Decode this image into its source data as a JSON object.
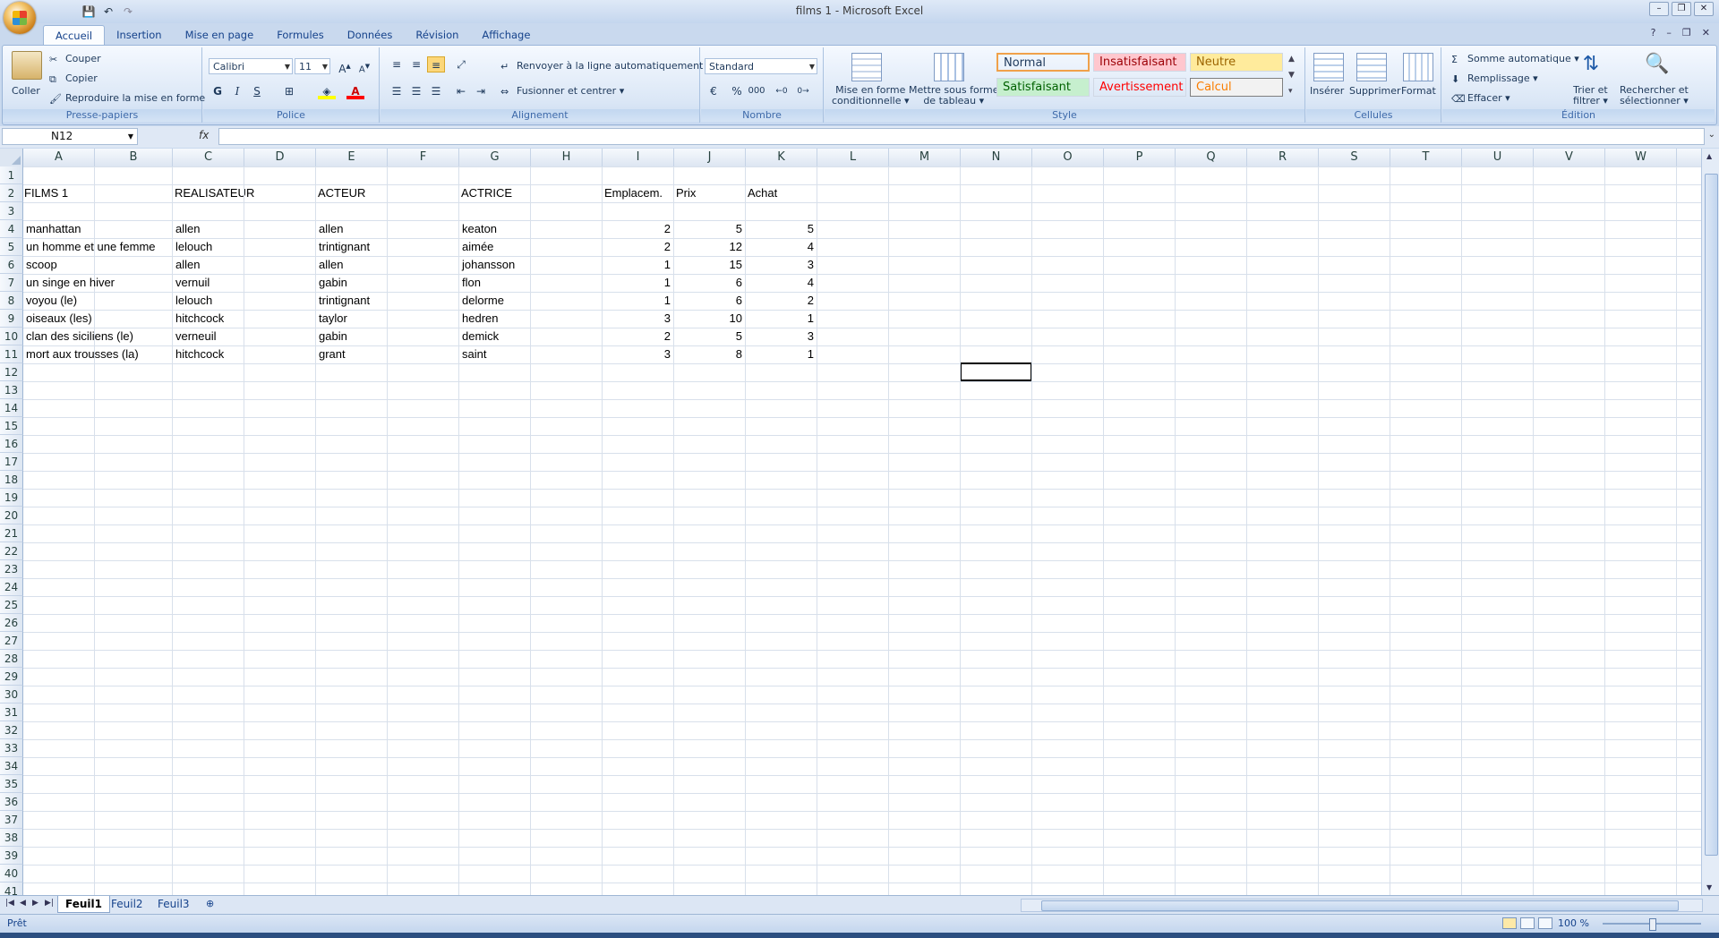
{
  "window": {
    "title": "films 1 - Microsoft Excel",
    "controls": [
      "–",
      "❐",
      "✕"
    ]
  },
  "qat": {
    "icons": [
      "save-icon",
      "undo-icon",
      "redo-icon"
    ]
  },
  "tabs": [
    {
      "label": "Accueil",
      "active": true
    },
    {
      "label": "Insertion"
    },
    {
      "label": "Mise en page"
    },
    {
      "label": "Formules"
    },
    {
      "label": "Données"
    },
    {
      "label": "Révision"
    },
    {
      "label": "Affichage"
    }
  ],
  "ribbon": {
    "clipboard": {
      "label": "Presse-papiers",
      "paste": "Coller",
      "cut": "Couper",
      "copy": "Copier",
      "format_painter": "Reproduire la mise en forme"
    },
    "font": {
      "label": "Police",
      "name": "Calibri",
      "size": "11",
      "bold": "G",
      "italic": "I",
      "underline": "S"
    },
    "alignment": {
      "label": "Alignement",
      "wrap": "Renvoyer à la ligne automatiquement",
      "merge": "Fusionner et centrer"
    },
    "number": {
      "label": "Nombre",
      "format": "Standard",
      "percent": "%",
      "thousands": "000"
    },
    "style": {
      "label": "Style",
      "conditional": [
        "Mise en forme",
        "conditionnelle"
      ],
      "table": [
        "Mettre sous forme",
        "de tableau"
      ],
      "cells": [
        {
          "label": "Normal",
          "bg": "#ffffff",
          "fg": "#000000"
        },
        {
          "label": "Insatisfaisant",
          "bg": "#ffc7ce",
          "fg": "#9c0006"
        },
        {
          "label": "Neutre",
          "bg": "#ffeb9c",
          "fg": "#9c6500"
        },
        {
          "label": "Satisfaisant",
          "bg": "#c6efce",
          "fg": "#006100"
        },
        {
          "label": "Avertissement",
          "bg": "#ffffff",
          "fg": "#ff0000"
        },
        {
          "label": "Calcul",
          "bg": "#f2f2f2",
          "fg": "#fa7d00"
        }
      ]
    },
    "cells": {
      "label": "Cellules",
      "insert": "Insérer",
      "delete": "Supprimer",
      "format": "Format"
    },
    "editing": {
      "label": "Édition",
      "autosum": "Somme automatique",
      "fill": "Remplissage",
      "clear": "Effacer",
      "sort": [
        "Trier et",
        "filtrer"
      ],
      "find": [
        "Rechercher et",
        "sélectionner"
      ]
    }
  },
  "formula_bar": {
    "name_box": "N12",
    "fx": "fx",
    "value": ""
  },
  "sheet": {
    "columns": [
      "A",
      "B",
      "C",
      "D",
      "E",
      "F",
      "G",
      "H",
      "I",
      "J",
      "K",
      "L",
      "M",
      "N",
      "O",
      "P",
      "Q",
      "R",
      "S",
      "T",
      "U",
      "V",
      "W"
    ],
    "row_count": 41,
    "headers": {
      "A2": "FILMS 1",
      "C2": "REALISATEUR",
      "E2": "ACTEUR",
      "G2": "ACTRICE",
      "I2": "Emplacem.",
      "J2": "Prix",
      "K2": "Achat"
    },
    "rows": [
      {
        "film": "manhattan",
        "realisateur": "allen",
        "acteur": "allen",
        "actrice": "keaton",
        "emplacement": 2,
        "prix": 5,
        "achat": 5
      },
      {
        "film": "un homme et une femme",
        "realisateur": "lelouch",
        "acteur": "trintignant",
        "actrice": "aimée",
        "emplacement": 2,
        "prix": 12,
        "achat": 4
      },
      {
        "film": "scoop",
        "realisateur": "allen",
        "acteur": "allen",
        "actrice": "johansson",
        "emplacement": 1,
        "prix": 15,
        "achat": 3
      },
      {
        "film": "un singe en hiver",
        "realisateur": "vernuil",
        "acteur": "gabin",
        "actrice": "flon",
        "emplacement": 1,
        "prix": 6,
        "achat": 4
      },
      {
        "film": "voyou (le)",
        "realisateur": "lelouch",
        "acteur": "trintignant",
        "actrice": "delorme",
        "emplacement": 1,
        "prix": 6,
        "achat": 2
      },
      {
        "film": "oiseaux (les)",
        "realisateur": "hitchcock",
        "acteur": "taylor",
        "actrice": "hedren",
        "emplacement": 3,
        "prix": 10,
        "achat": 1
      },
      {
        "film": "clan des siciliens (le)",
        "realisateur": "verneuil",
        "acteur": "gabin",
        "actrice": "demick",
        "emplacement": 2,
        "prix": 5,
        "achat": 3
      },
      {
        "film": "mort aux trousses (la)",
        "realisateur": "hitchcock",
        "acteur": "grant",
        "actrice": "saint",
        "emplacement": 3,
        "prix": 8,
        "achat": 1
      }
    ],
    "selected": "N12"
  },
  "sheet_tabs": [
    {
      "label": "Feuil1",
      "active": true
    },
    {
      "label": "Feuil2"
    },
    {
      "label": "Feuil3"
    }
  ],
  "status": {
    "text": "Prêt",
    "zoom": "100 %"
  }
}
